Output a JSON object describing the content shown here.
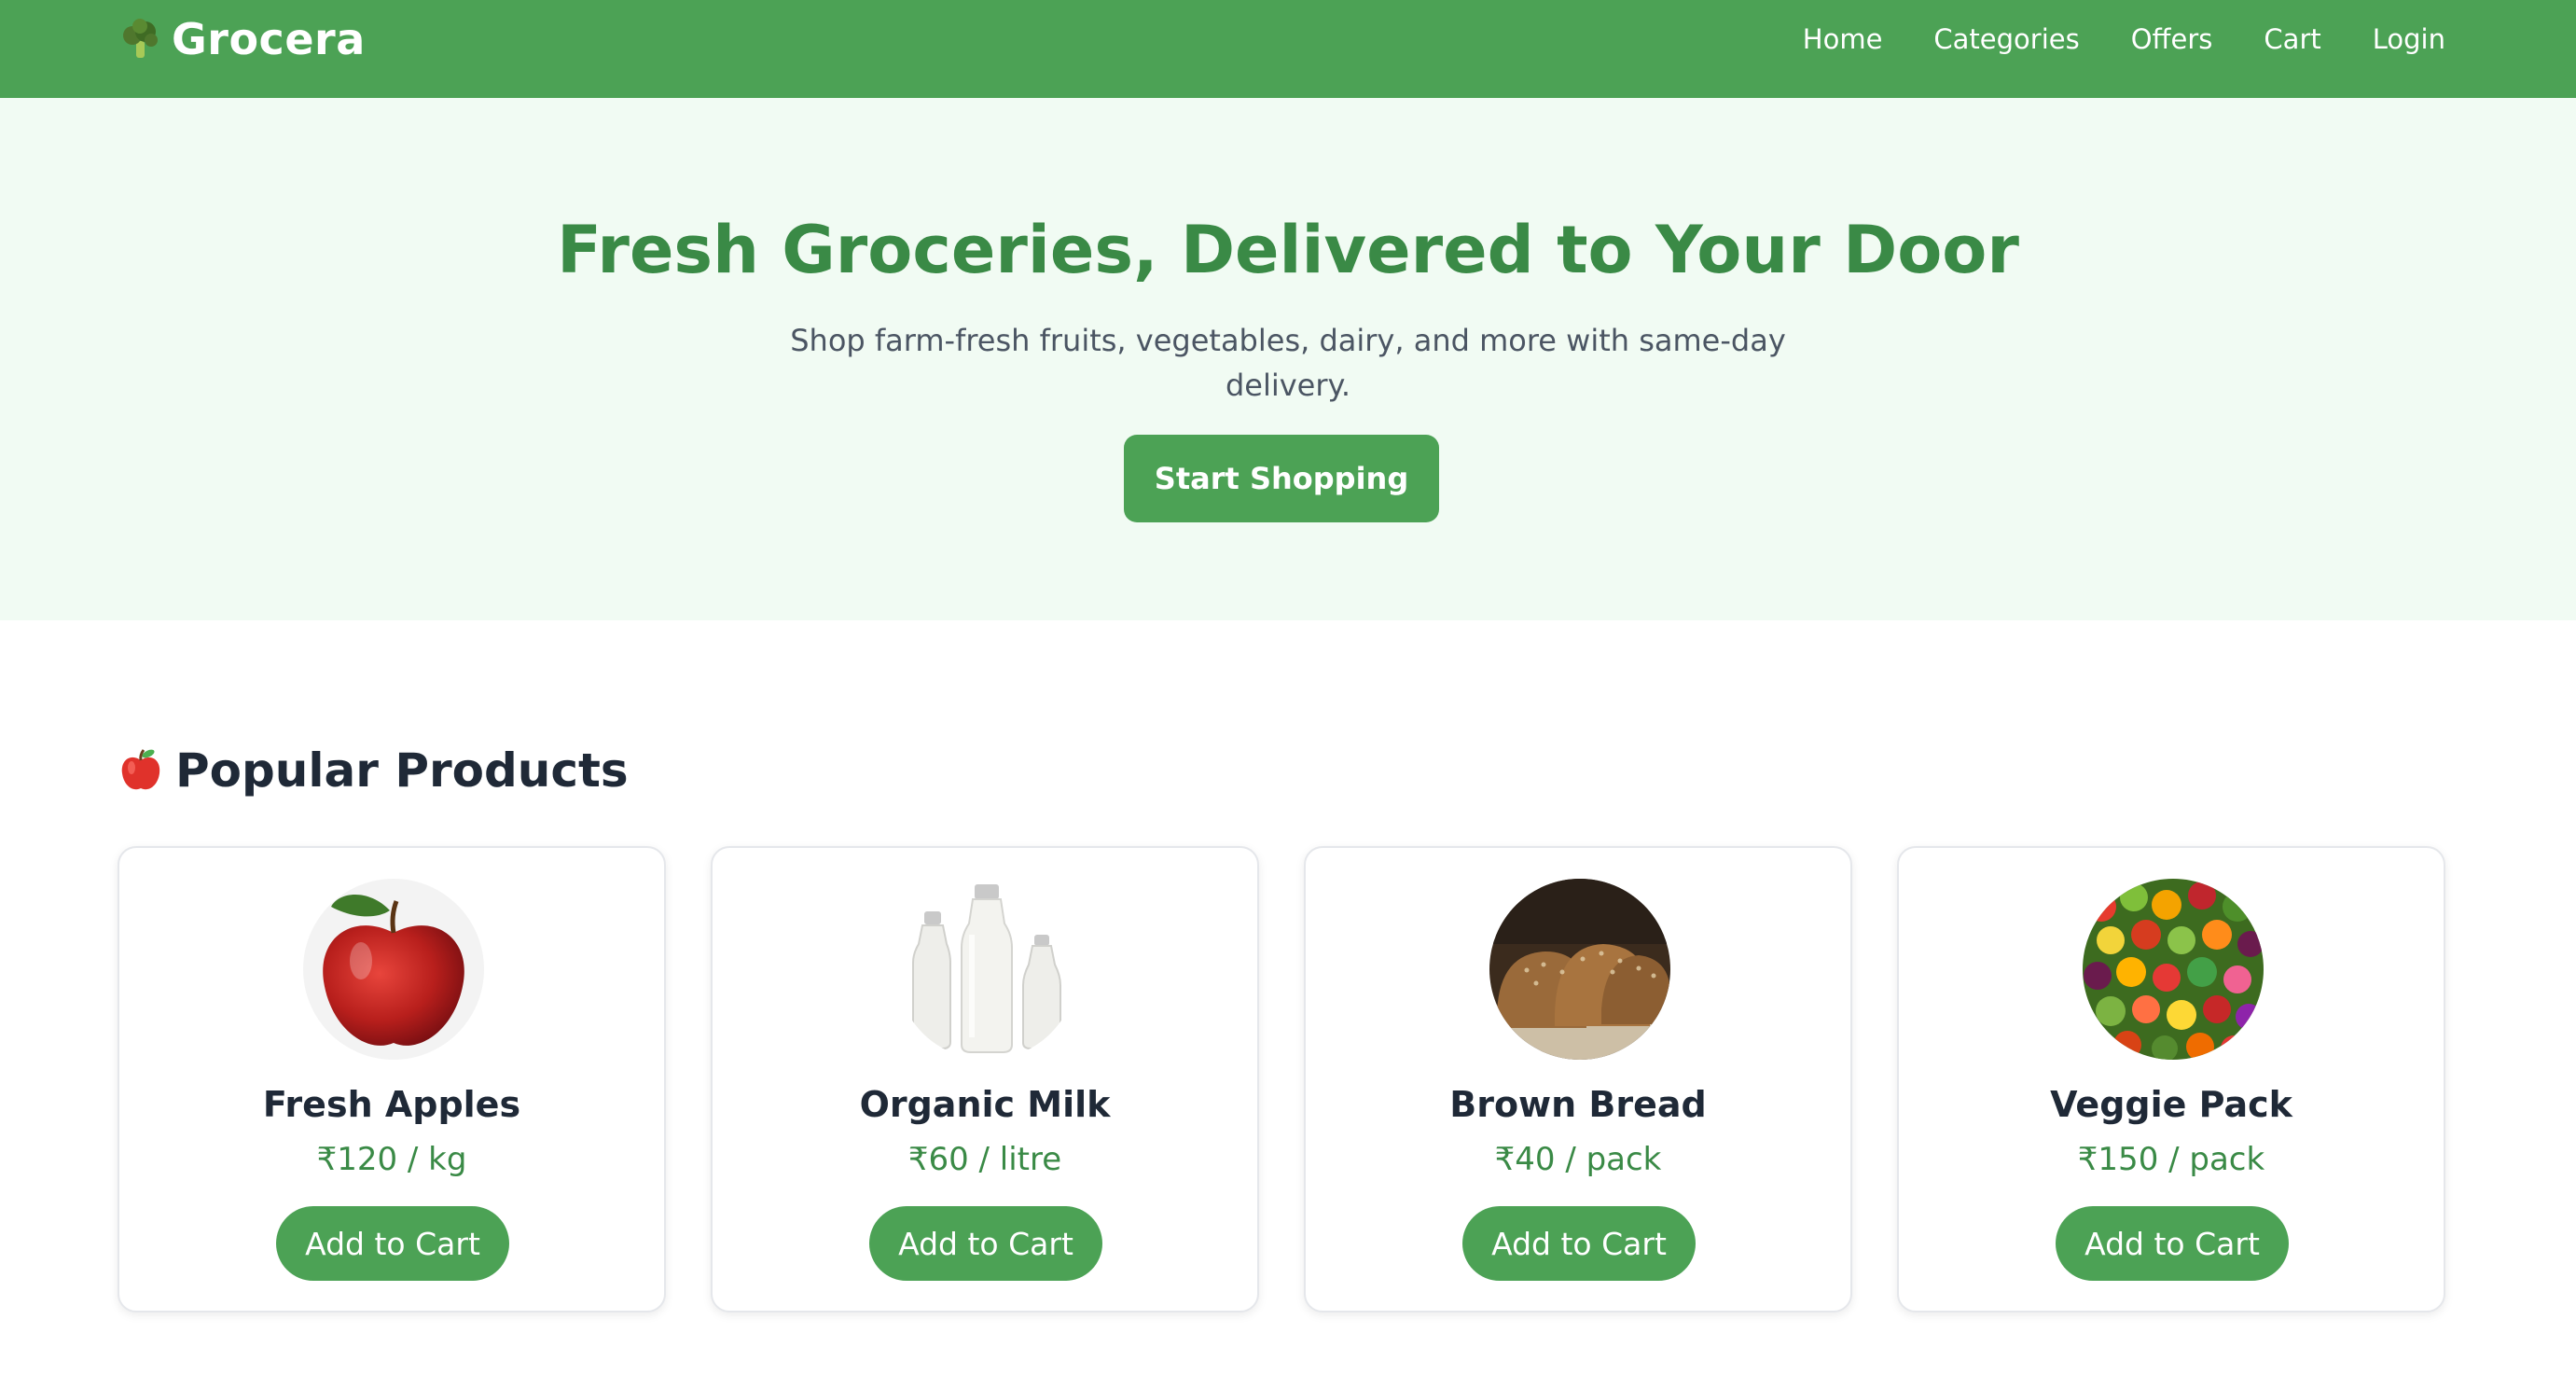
{
  "header": {
    "brand_icon": "broccoli-icon",
    "brand_name": "Grocera",
    "nav": [
      "Home",
      "Categories",
      "Offers",
      "Cart",
      "Login"
    ]
  },
  "hero": {
    "title": "Fresh Groceries, Delivered to Your Door",
    "subtitle": "Shop farm-fresh fruits, vegetables, dairy, and more with same-day delivery.",
    "cta_label": "Start Shopping"
  },
  "popular": {
    "icon": "apple-icon",
    "title": "Popular Products",
    "products": [
      {
        "name": "Fresh Apples",
        "price": "₹120 / kg",
        "image": "apple-image",
        "button": "Add to Cart"
      },
      {
        "name": "Organic Milk",
        "price": "₹60 / litre",
        "image": "milk-bottles-image",
        "button": "Add to Cart"
      },
      {
        "name": "Brown Bread",
        "price": "₹40 / pack",
        "image": "brown-bread-image",
        "button": "Add to Cart"
      },
      {
        "name": "Veggie Pack",
        "price": "₹150 / pack",
        "image": "vegetables-image",
        "button": "Add to Cart"
      }
    ]
  },
  "colors": {
    "primary": "#4ca255",
    "heading_green": "#3a8a46",
    "hero_bg": "#f1fbf3",
    "text_dark": "#1f2937",
    "text_muted": "#4b5563"
  }
}
